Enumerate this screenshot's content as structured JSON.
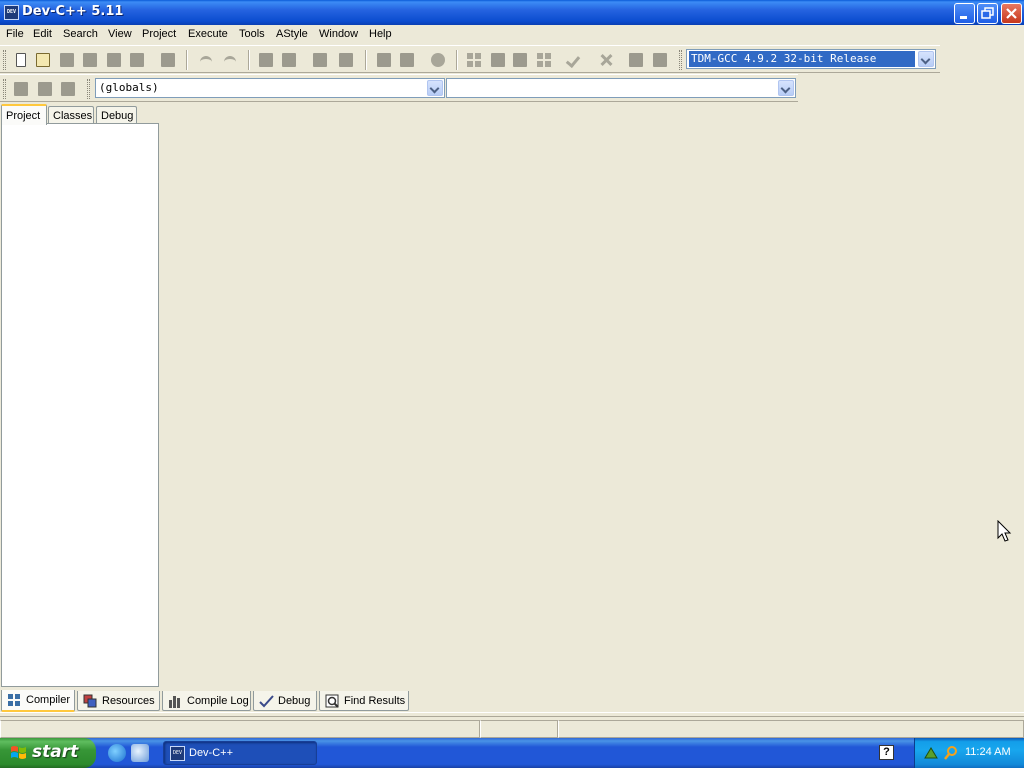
{
  "window": {
    "title": "Dev-C++ 5.11",
    "app_icon_text": "DEV"
  },
  "menu": {
    "items": [
      "File",
      "Edit",
      "Search",
      "View",
      "Project",
      "Execute",
      "Tools",
      "AStyle",
      "Window",
      "Help"
    ]
  },
  "toolbar": {
    "compiler_selected": "TDM-GCC 4.9.2 32-bit Release",
    "scope_selected": "(globals)",
    "member_selected": ""
  },
  "left_panel": {
    "tabs": [
      "Project",
      "Classes",
      "Debug"
    ],
    "active_tab": "Project"
  },
  "bottom_panel": {
    "tabs": [
      "Compiler",
      "Resources",
      "Compile Log",
      "Debug",
      "Find Results"
    ]
  },
  "taskbar": {
    "start_label": "start",
    "task_label": "Dev-C++",
    "help_label": "?",
    "clock": "11:24 AM"
  },
  "colors": {
    "window_bg": "#ece9d8",
    "titlebar": "#0b4ccf",
    "selection": "#316ac5",
    "taskbar": "#2157d7",
    "start_button": "#379637",
    "tray": "#18a6ee"
  }
}
